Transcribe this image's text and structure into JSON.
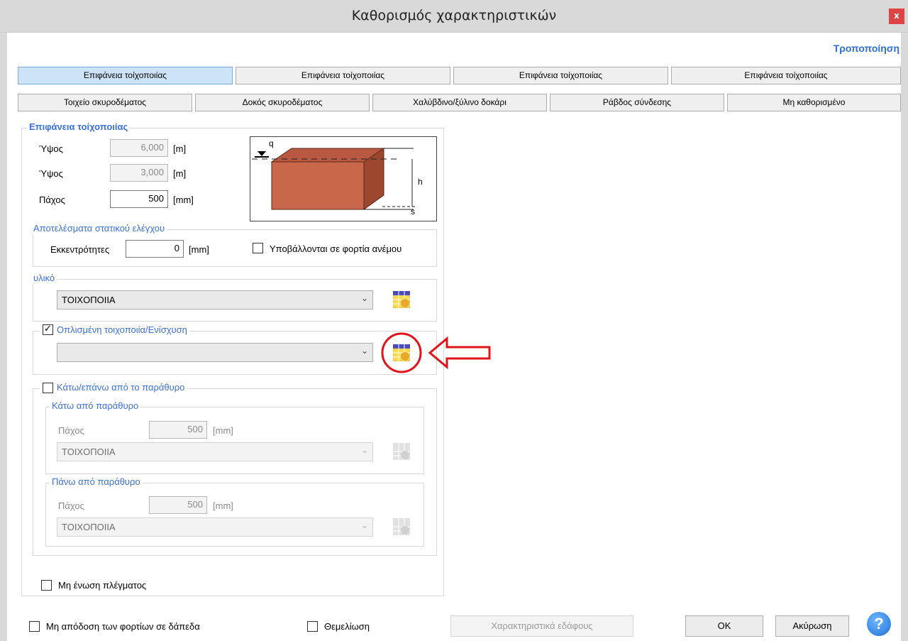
{
  "window": {
    "title": "Καθορισμός χαρακτηριστικών",
    "close_glyph": "x"
  },
  "modify_label": "Τροποποίηση",
  "tabs_row1": [
    "Επιφάνεια τοίχοποιίας",
    "Επιφάνεια τοίχοποιίας",
    "Επιφάνεια τοίχοποιίας",
    "Επιφάνεια τοίχοποιίας"
  ],
  "tabs_row2": [
    "Τοιχείο σκυροδέματος",
    "Δοκός σκυροδέματος",
    "Χαλύβδινο/ξύλινο δοκάρι",
    "Ράβδος σύνδεσης",
    "Μη καθορισμένο"
  ],
  "surface": {
    "legend": "Επιφάνεια τοίχοποιίας",
    "height1": {
      "label": "Ύψος",
      "value": "6,000",
      "unit": "[m]"
    },
    "height2": {
      "label": "Ύψος",
      "value": "3,000",
      "unit": "[m]"
    },
    "thickness": {
      "label": "Πάχος",
      "value": "500",
      "unit": "[mm]"
    },
    "diagram": {
      "q": "q",
      "h": "h",
      "s": "s"
    }
  },
  "static": {
    "legend": "Αποτελέσματα στατικού ελέγχου",
    "eccentricity_label": "Εκκεντρότητες",
    "eccentricity_value": "0",
    "eccentricity_unit": "[mm]",
    "wind_label": "Υποβάλλονται σε φορτία ανέμου",
    "wind_checked": false
  },
  "material": {
    "legend": "υλικό",
    "value": "ΤΟΙΧΟΠΟΙΙΑ"
  },
  "reinforced": {
    "legend": "Οπλισμένη τοιχοποιία/Ενίσχυση",
    "checked": true,
    "value": ""
  },
  "window_section": {
    "legend": "Κάτω/επάνω από το παράθυρο",
    "checked": false,
    "below": {
      "legend": "Κάτω από παράθυρο",
      "thickness_label": "Πάχος",
      "thickness_value": "500",
      "unit": "[mm]",
      "material": "ΤΟΙΧΟΠΟΙΙΑ"
    },
    "above": {
      "legend": "Πάνω από παράθυρο",
      "thickness_label": "Πάχος",
      "thickness_value": "500",
      "unit": "[mm]",
      "material": "ΤΟΙΧΟΠΟΙΙΑ"
    }
  },
  "mesh_label": "Μη ένωση πλέγματος",
  "footer": {
    "no_load_transfer": "Μη απόδοση των φορτίων σε δάπεδα",
    "foundation": "Θεμελίωση",
    "soil_button": "Χαρακτηριστικά εδάφους",
    "ok": "OK",
    "cancel": "Ακύρωση",
    "help": "?"
  },
  "colors": {
    "accent": "#3a70d5",
    "brick": "#c9674a",
    "annotation": "#e0141a"
  }
}
